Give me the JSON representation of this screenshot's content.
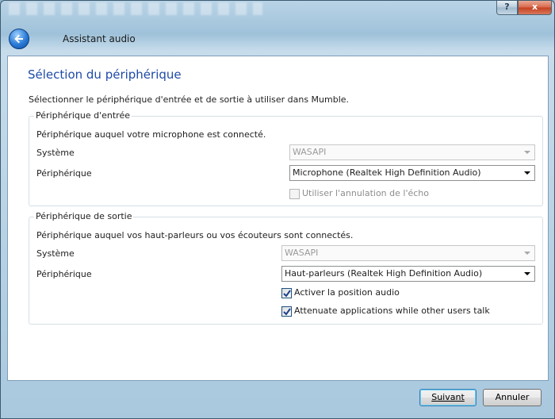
{
  "titlebar": {
    "help_label": "?",
    "close_label": "x",
    "title": "Assistant audio"
  },
  "page": {
    "title": "Sélection du périphérique",
    "description": "Sélectionner le périphérique d'entrée et de sortie à utiliser dans Mumble."
  },
  "input_group": {
    "title": "Périphérique d'entrée",
    "info": "Périphérique auquel votre microphone est connecté.",
    "system_label": "Système",
    "system_value": "WASAPI",
    "device_label": "Périphérique",
    "device_value": "Microphone (Realtek High Definition Audio)",
    "echo_label": "Utiliser l'annulation de l'écho",
    "echo_checked": false
  },
  "output_group": {
    "title": "Périphérique de sortie",
    "info": "Périphérique auquel vos haut-parleurs ou vos écouteurs sont connectés.",
    "system_label": "Système",
    "system_value": "WASAPI",
    "device_label": "Périphérique",
    "device_value": "Haut-parleurs (Realtek High Definition Audio)",
    "positional_label": "Activer la position audio",
    "positional_checked": true,
    "attenuate_label": "Attenuate applications while other users talk",
    "attenuate_checked": true
  },
  "footer": {
    "next_label": "Suivant",
    "cancel_label": "Annuler"
  },
  "colors": {
    "accent_title": "#1e4aa8",
    "close_red": "#c4401f"
  }
}
